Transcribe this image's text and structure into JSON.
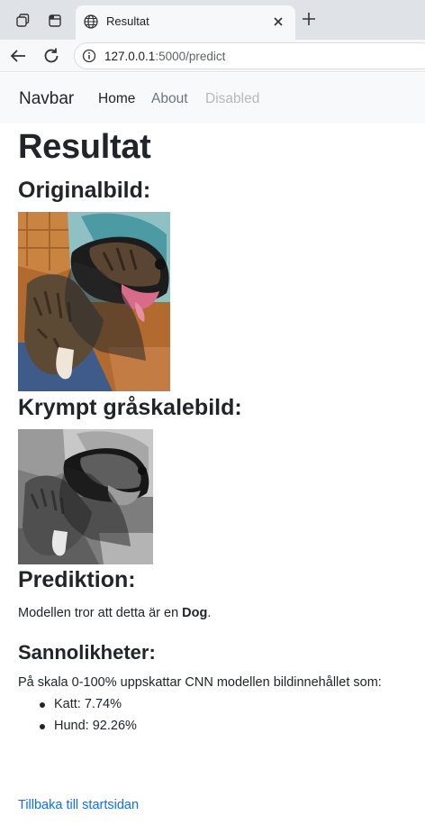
{
  "browser": {
    "tab_title": "Resultat",
    "url_host": "127.0.0.1",
    "url_rest": ":5000/predict"
  },
  "navbar": {
    "brand": "Navbar",
    "links": [
      "Home",
      "About",
      "Disabled"
    ]
  },
  "page": {
    "title": "Resultat",
    "original_heading": "Originalbild:",
    "gray_heading": "Krympt gråskalebild:",
    "prediction_heading": "Prediktion:",
    "prediction_prefix": "Modellen tror att detta är en ",
    "prediction_label": "Dog",
    "prediction_suffix": ".",
    "probabilities_heading": "Sannolikheter:",
    "probabilities_intro": "På skala 0-100% uppskattar CNN modellen bildinnehållet som:",
    "probabilities": [
      {
        "label": "Katt: 7.74%"
      },
      {
        "label": "Hund: 92.26%"
      }
    ],
    "back_link": "Tillbaka till startsidan"
  },
  "colors": {
    "link": "#0d6efd",
    "navbar_bg": "#f8f9fa"
  }
}
